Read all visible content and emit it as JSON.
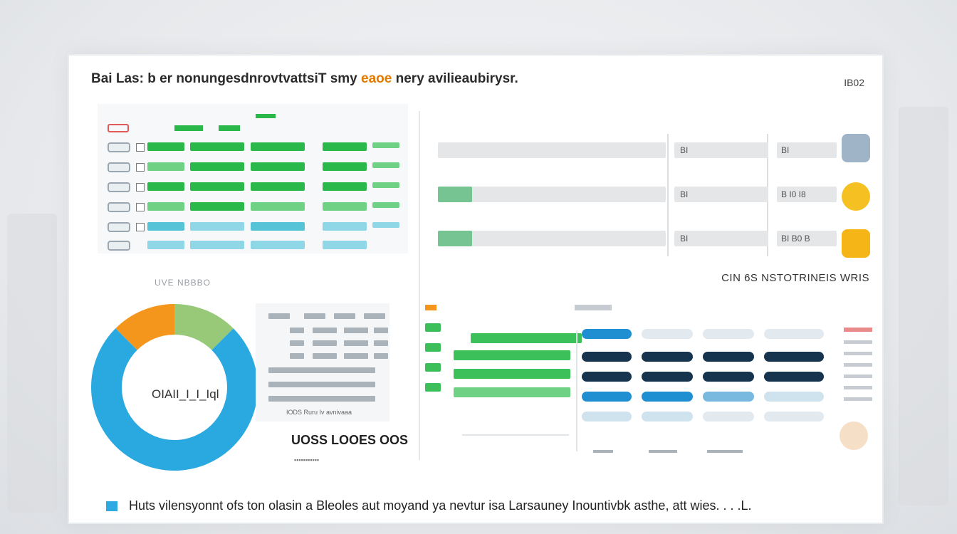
{
  "header": {
    "title_main": "Bai Las: b er nonungesdnrovtvattsiT smy ",
    "title_highlight": "eaoe",
    "title_tail": " nery avilieaubirysr.",
    "code": "IB02"
  },
  "top_left": {
    "subtitle": "UVE NBBBO"
  },
  "top_right": {
    "rows": [
      {
        "fill": 0.0,
        "mid": "BI",
        "end": "BI"
      },
      {
        "fill": 0.15,
        "mid": "BI",
        "end": "B I0 I8"
      },
      {
        "fill": 0.15,
        "mid": "BI",
        "end": "BI B0 B"
      }
    ],
    "label": "CIN 6S NSTOTRINEIS WRIS"
  },
  "donut": {
    "center_label": "OIAII_I_I_Iql",
    "segments": [
      {
        "name": "blue",
        "value": 0.75,
        "color": "#2aa8e0"
      },
      {
        "name": "orange",
        "value": 0.125,
        "color": "#f4961b"
      },
      {
        "name": "green",
        "value": 0.125,
        "color": "#97c978"
      }
    ]
  },
  "mini_table": {
    "note": "IODS Ruru Iv avnivaaa",
    "footer": "UOSS LOOES OOS",
    "dots": "▪▪▪▪▪▪▪▪▪▪▪"
  },
  "footer": {
    "text": "Huts vilensyonnt ofs ton olasin a Bleoles aut moyand ya nevtur isa Larsauney Inountivbk asthe, att wies. . . .L."
  },
  "colors": {
    "green": "#2bb84a",
    "teal": "#56c3d6",
    "navy": "#16344d",
    "blue": "#1f8fd1",
    "orange": "#f4961b"
  }
}
